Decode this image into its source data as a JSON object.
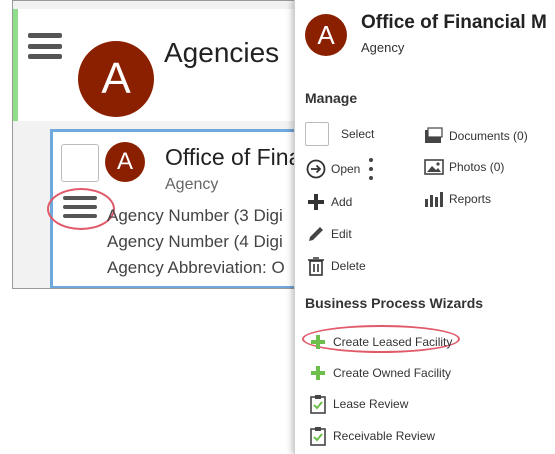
{
  "left": {
    "title": "Agencies",
    "avatar_letter": "A",
    "card": {
      "avatar_letter": "A",
      "title": "Office of Fina",
      "subtitle": "Agency",
      "lines": [
        "Agency Number (3 Digi",
        "Agency Number (4 Digi",
        "Agency Abbreviation: O"
      ]
    }
  },
  "menu": {
    "avatar_letter": "A",
    "title": "Office of Financial M",
    "subtitle": "Agency",
    "manage_title": "Manage",
    "manage_left": {
      "select": "Select",
      "open": "Open",
      "add": "Add",
      "edit": "Edit",
      "delete": "Delete"
    },
    "manage_right": {
      "documents": "Documents (0)",
      "photos": "Photos (0)",
      "reports": "Reports"
    },
    "wizards_title": "Business Process Wizards",
    "wizards": {
      "leased": "Create Leased Facility",
      "owned": "Create Owned Facility",
      "lease_review": "Lease Review",
      "receivable_review": "Receivable Review"
    }
  },
  "colors": {
    "avatar_bg": "#8b2000",
    "green_accent": "#8ede8a",
    "card_border": "#6fa8dc",
    "highlight_circle": "#e05a6a",
    "plus_green": "#6cbf4a"
  },
  "icons": [
    "hamburger-icon",
    "arrow-circle-right-icon",
    "kebab-icon",
    "plus-icon",
    "pencil-icon",
    "trash-icon",
    "documents-icon",
    "photos-icon",
    "reports-icon",
    "clipboard-check-icon"
  ]
}
